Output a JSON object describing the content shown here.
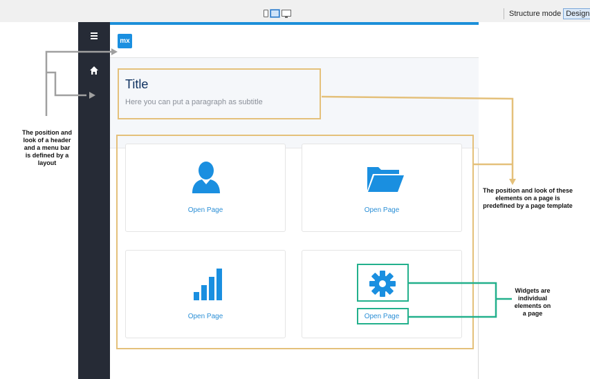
{
  "toolbar": {
    "modes": [
      "Structure mode",
      "Design mod"
    ],
    "active_mode": "Design mod"
  },
  "header": {
    "logo_text": "mx"
  },
  "title_section": {
    "title": "Title",
    "subtitle": "Here you can put a paragraph as subtitle"
  },
  "cards": [
    {
      "icon": "user-icon",
      "label": "Open Page"
    },
    {
      "icon": "folder-icon",
      "label": "Open Page"
    },
    {
      "icon": "signal-bars-icon",
      "label": "Open Page"
    },
    {
      "icon": "gear-icon",
      "label": "Open Page"
    }
  ],
  "annotations": {
    "layout": "The position and look of a header and a menu bar is defined by a layout",
    "template": "The position and look of these elements on a page is predefined by a page template",
    "widgets": "Widgets are individual elements on a page"
  },
  "colors": {
    "sidebar": "#262b36",
    "accent": "#1c8fd9",
    "template_outline": "#e4c07a",
    "widget_outline": "#22b08c",
    "layout_arrow": "#a0a0a0"
  }
}
